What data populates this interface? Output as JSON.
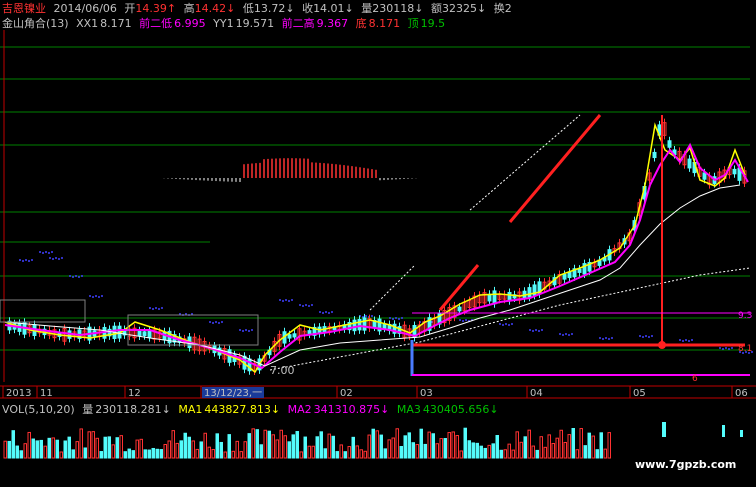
{
  "header": {
    "stock_name": "吉恩镍业",
    "date": "2014/06/06",
    "open_label": "开",
    "open": "14.39↑",
    "high_label": "高",
    "high": "14.42↓",
    "low_label": "低",
    "low": "13.72↓",
    "close_label": "收",
    "close": "14.01↓",
    "volume_label": "量",
    "volume": "230118↓",
    "amount_label": "额",
    "amount": "32325↓",
    "turnover_label": "换",
    "turnover": "2"
  },
  "indicator": {
    "name": "金山角合(13)",
    "xx1_label": "XX1",
    "xx1": "8.171",
    "prev2_low_label": "前二低",
    "prev2_low": "6.995",
    "yy1_label": "YY1",
    "yy1": "19.571",
    "prev2_high_label": "前二高",
    "prev2_high": "9.367",
    "bottom_label": "底",
    "bottom": "8.171",
    "top_label": "顶",
    "top": "19.5"
  },
  "price_labels": {
    "low_point": "7.00",
    "level_1": "9.3",
    "level_2": "8.1",
    "level_3": "6"
  },
  "x_axis": {
    "labels": [
      "2013",
      "11",
      "12",
      "13/12/23,一",
      "02",
      "03",
      "04",
      "05",
      "06"
    ]
  },
  "volume_panel": {
    "title": "VOL(5,10,20)",
    "vol_label": "量",
    "vol": "230118.281↓",
    "ma1_label": "MA1",
    "ma1": "443827.813↓",
    "ma2_label": "MA2",
    "ma2": "341310.875↓",
    "ma3_label": "MA3",
    "ma3": "430405.656↓"
  },
  "watermark": "www.7gpzb.com",
  "colors": {
    "bg": "#000000",
    "up": "#ff3232",
    "down": "#54fcfc",
    "yellow": "#ffff00",
    "magenta": "#ff00ff",
    "green": "#00c000",
    "white": "#ffffff",
    "gray": "#c0c0c0",
    "blue": "#4040ff"
  }
}
